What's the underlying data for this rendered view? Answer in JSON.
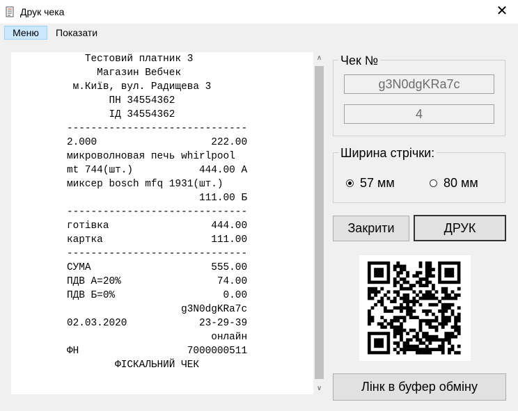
{
  "window": {
    "title": "Друк чека",
    "close_glyph": "✕",
    "icon": "document-icon"
  },
  "menu": {
    "items": [
      {
        "label": "Меню",
        "active": true
      },
      {
        "label": "Показати",
        "active": false
      }
    ]
  },
  "receipt": {
    "lines": [
      "   Тестовий платник 3",
      "     Магазин Вебчек",
      " м.Київ, вул. Радищева 3",
      "       ПН 34554362",
      "       ІД 34554362",
      "------------------------------",
      "2.000                   222.00",
      "микроволновая печь whirlpool",
      "mt 744(шт.)           444.00 А",
      "миксер bosch mfq 1931(шт.)",
      "                      111.00 Б",
      "------------------------------",
      "готівка                 444.00",
      "картка                  111.00",
      "------------------------------",
      "СУМА                    555.00",
      "ПДВ А=20%                74.00",
      "ПДВ Б=0%                  0.00",
      "                   g3N0dgKRa7c",
      "02.03.2020            23-29-39",
      "                        онлайн",
      "ФН                  7000000511",
      "        ФІСКАЛЬНИЙ ЧЕК"
    ]
  },
  "scrollbar": {
    "up": "∧",
    "down": "∨"
  },
  "check_group": {
    "title": "Чек №",
    "number": "g3N0dgKRa7c",
    "index": "4"
  },
  "width_group": {
    "title": "Ширина стрічки:",
    "options": [
      {
        "label": "57 мм",
        "checked": true
      },
      {
        "label": "80 мм",
        "checked": false
      }
    ]
  },
  "buttons": {
    "close": "Закрити",
    "print": "ДРУК",
    "copy_link": "Лінк в буфер обміну"
  },
  "qr": {
    "icon": "qr-code-image"
  },
  "colors": {
    "window": "#f0f0f0",
    "menu_highlight": "#cce8ff",
    "field_text": "#6d6d6d"
  }
}
